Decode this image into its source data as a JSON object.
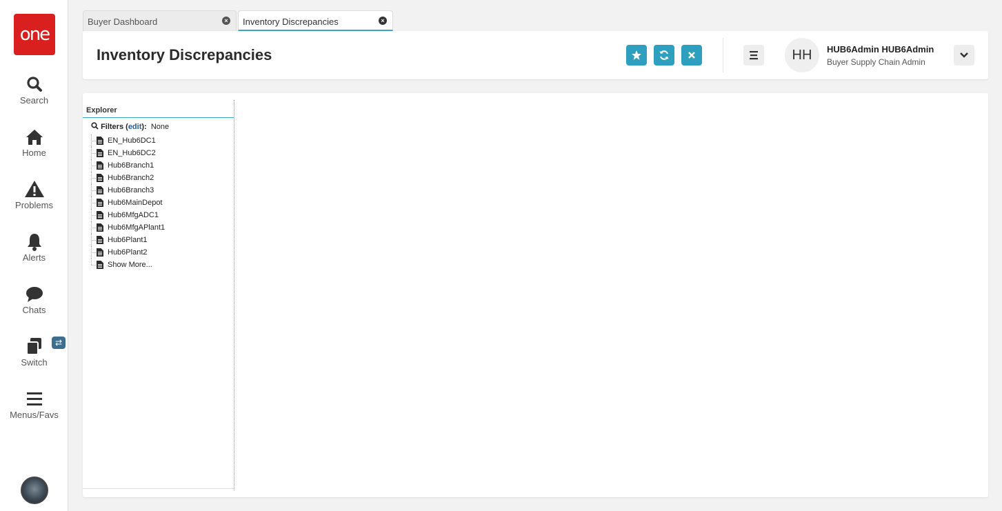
{
  "app": {
    "logo_text": "one",
    "brand_color": "#d9201f",
    "accent_color": "#2f9fc0"
  },
  "sidenav": {
    "items": [
      {
        "label": "Search",
        "icon": "search-icon"
      },
      {
        "label": "Home",
        "icon": "home-icon"
      },
      {
        "label": "Problems",
        "icon": "warning-icon"
      },
      {
        "label": "Alerts",
        "icon": "bell-icon"
      },
      {
        "label": "Chats",
        "icon": "chat-icon"
      },
      {
        "label": "Switch",
        "icon": "switch-icon",
        "badge_icon": "swap-icon"
      },
      {
        "label": "Menus/Favs",
        "icon": "menu-icon"
      }
    ]
  },
  "tabs": [
    {
      "label": "Buyer Dashboard",
      "active": false
    },
    {
      "label": "Inventory Discrepancies",
      "active": true
    }
  ],
  "header": {
    "title": "Inventory Discrepancies",
    "actions": [
      "star-icon",
      "refresh-icon",
      "close-icon"
    ],
    "user": {
      "initials": "HH",
      "name": "HUB6Admin HUB6Admin",
      "role": "Buyer Supply Chain Admin"
    }
  },
  "explorer": {
    "title": "Explorer",
    "filters_label": "Filters",
    "edit_label": "edit",
    "filters_value": "None",
    "items": [
      "EN_Hub6DC1",
      "EN_Hub6DC2",
      "Hub6Branch1",
      "Hub6Branch2",
      "Hub6Branch3",
      "Hub6MainDepot",
      "Hub6MfgADC1",
      "Hub6MfgAPlant1",
      "Hub6Plant1",
      "Hub6Plant2",
      "Show More..."
    ]
  }
}
